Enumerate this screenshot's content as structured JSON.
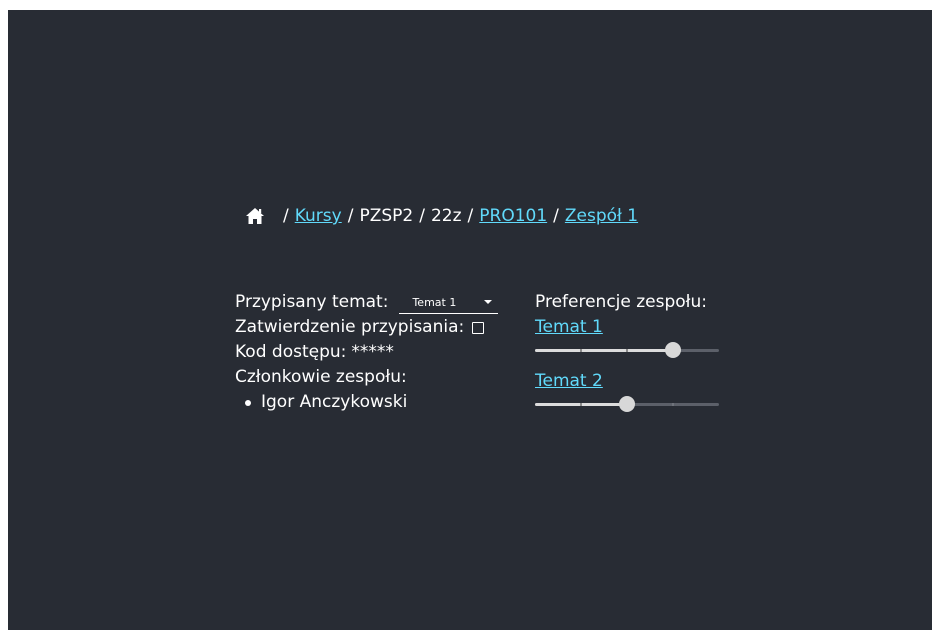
{
  "breadcrumb": {
    "home_icon": "home-icon",
    "separator": "/",
    "items": [
      {
        "label": "Kursy",
        "link": true
      },
      {
        "label": "PZSP2",
        "link": false
      },
      {
        "label": "22z",
        "link": false
      },
      {
        "label": "PRO101",
        "link": true
      },
      {
        "label": "Zespół 1",
        "link": true
      }
    ]
  },
  "info": {
    "assigned_topic_label": "Przypisany temat:",
    "assigned_topic_value": "Temat 1",
    "approval_label": "Zatwierdzenie przypisania:",
    "approval_checked": false,
    "access_code_label": "Kod dostępu:",
    "access_code_value": "*****",
    "members_label": "Członkowie zespołu:",
    "members": [
      "Igor Anczykowski"
    ]
  },
  "preferences": {
    "label": "Preferencje zespołu:",
    "topics": [
      {
        "name": "Temat 1",
        "value": 3,
        "max": 4
      },
      {
        "name": "Temat 2",
        "value": 2,
        "max": 4
      }
    ]
  },
  "colors": {
    "background": "#282c34",
    "link": "#61dafb",
    "text": "#ffffff"
  }
}
